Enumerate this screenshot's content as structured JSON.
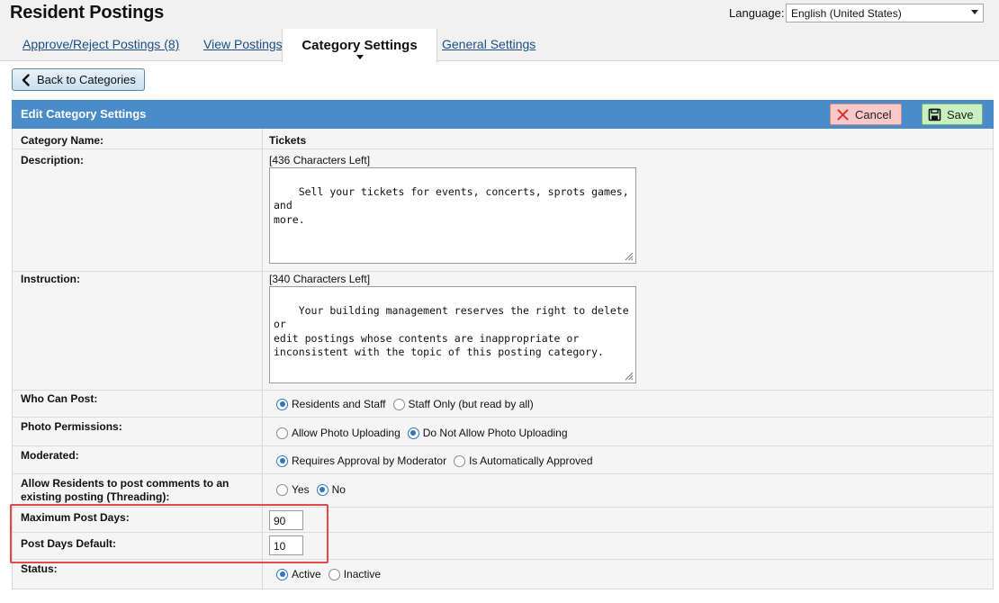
{
  "app": {
    "title": "Resident Postings"
  },
  "language": {
    "label": "Language:",
    "selected": "English (United States)"
  },
  "tabs": [
    {
      "label": "Approve/Reject Postings (8)"
    },
    {
      "label": "View Postings"
    },
    {
      "label": "Category Settings",
      "active": true
    },
    {
      "label": "General Settings"
    }
  ],
  "back_button": {
    "label": "Back to Categories"
  },
  "panel": {
    "title": "Edit Category Settings",
    "cancel_label": "Cancel",
    "save_label": "Save"
  },
  "form": {
    "category_name": {
      "label": "Category Name:",
      "value": "Tickets"
    },
    "description": {
      "label": "Description:",
      "counter": "[436 Characters Left]",
      "value": "Sell your tickets for events, concerts, sprots games, and\nmore."
    },
    "instruction": {
      "label": "Instruction:",
      "counter": "[340 Characters Left]",
      "value": "Your building management reserves the right to delete or\nedit postings whose contents are inappropriate or\ninconsistent with the topic of this posting category."
    },
    "who_can_post": {
      "label": "Who Can Post:",
      "options": [
        "Residents and Staff",
        "Staff Only (but read by all)"
      ],
      "selected": 0
    },
    "photo_permissions": {
      "label": "Photo Permissions:",
      "options": [
        "Allow Photo Uploading",
        "Do Not Allow Photo Uploading"
      ],
      "selected": 1
    },
    "moderated": {
      "label": "Moderated:",
      "options": [
        "Requires Approval by Moderator",
        "Is Automatically Approved"
      ],
      "selected": 0
    },
    "threading": {
      "label_line1": "Allow Residents to post comments to an",
      "label_line2": "existing posting (Threading):",
      "options": [
        "Yes",
        "No"
      ],
      "selected": 1
    },
    "max_post_days": {
      "label": "Maximum Post Days:",
      "value": "90"
    },
    "post_days_default": {
      "label": "Post Days Default:",
      "value": "10"
    },
    "status": {
      "label": "Status:",
      "options": [
        "Active",
        "Inactive"
      ],
      "selected": 0
    }
  },
  "colors": {
    "panel_header": "#4a8bc9",
    "link": "#1a4f86",
    "cancel_bg": "#f9c8c8",
    "save_bg": "#c8f0c0",
    "radio_selected": "#2f74c0",
    "highlight": "#e04a4a"
  },
  "icons": {
    "back": "chevron-left-icon",
    "cancel": "x-icon",
    "save": "floppy-disk-icon",
    "language_dropdown": "chevron-down-icon"
  }
}
